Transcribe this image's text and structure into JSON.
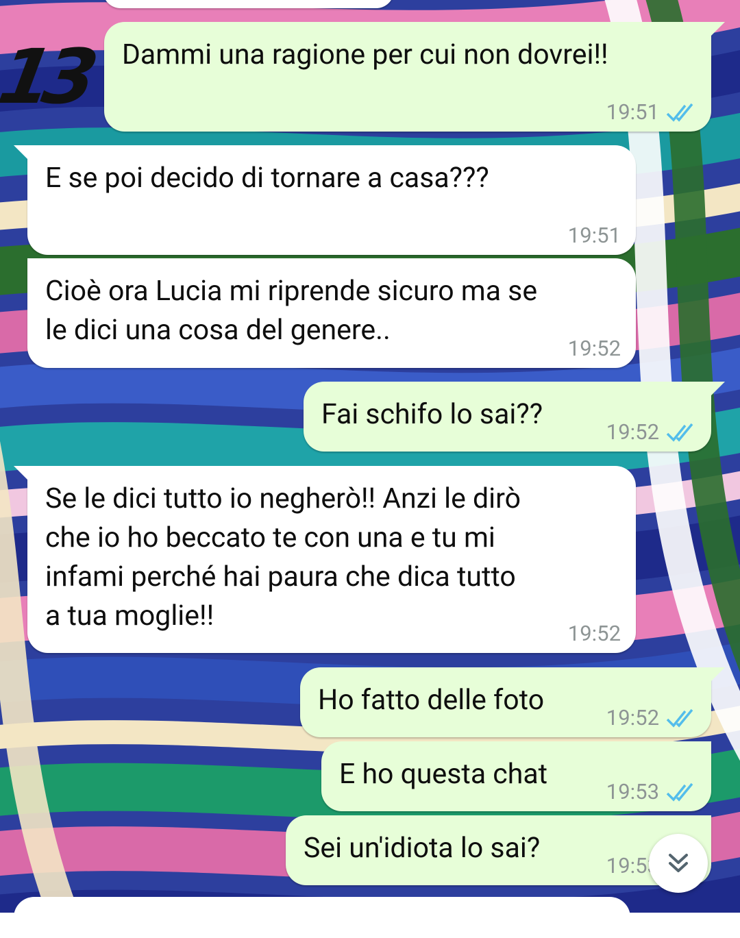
{
  "overlay_number": "13",
  "messages": [
    {
      "id": "m1",
      "direction": "out",
      "text": "Dammi una ragione per cui non dovrei!!",
      "time": "19:51",
      "status": "read"
    },
    {
      "id": "m2",
      "direction": "in",
      "text": "E se poi decido di tornare a casa???",
      "time": "19:51"
    },
    {
      "id": "m3",
      "direction": "in",
      "text": "Cioè ora Lucia mi riprende sicuro ma se\nle dici una cosa del genere..",
      "time": "19:52"
    },
    {
      "id": "m4",
      "direction": "out",
      "text": "Fai schifo lo sai??",
      "time": "19:52",
      "status": "read"
    },
    {
      "id": "m5",
      "direction": "in",
      "text": "Se le dici tutto io negherò!! Anzi le dirò\nche io ho beccato te con una e tu mi\ninfami perché hai paura che dica tutto\na tua moglie!!",
      "time": "19:52"
    },
    {
      "id": "m6",
      "direction": "out",
      "text": "Ho fatto delle foto",
      "time": "19:52",
      "status": "read"
    },
    {
      "id": "m7",
      "direction": "out",
      "text": "E ho questa chat",
      "time": "19:53",
      "status": "read"
    },
    {
      "id": "m8",
      "direction": "out",
      "text": "Sei un'idiota lo sai?",
      "time": "19:53",
      "status": "read"
    }
  ],
  "icons": {
    "read_receipt": "double-check-icon",
    "scroll_down": "double-chevron-down-icon"
  },
  "colors": {
    "outgoing_bubble": "#e7fed8",
    "incoming_bubble": "#ffffff",
    "read_tick": "#53bdeb",
    "timestamp": "#8d9494",
    "message_text": "#0e0e0e"
  }
}
